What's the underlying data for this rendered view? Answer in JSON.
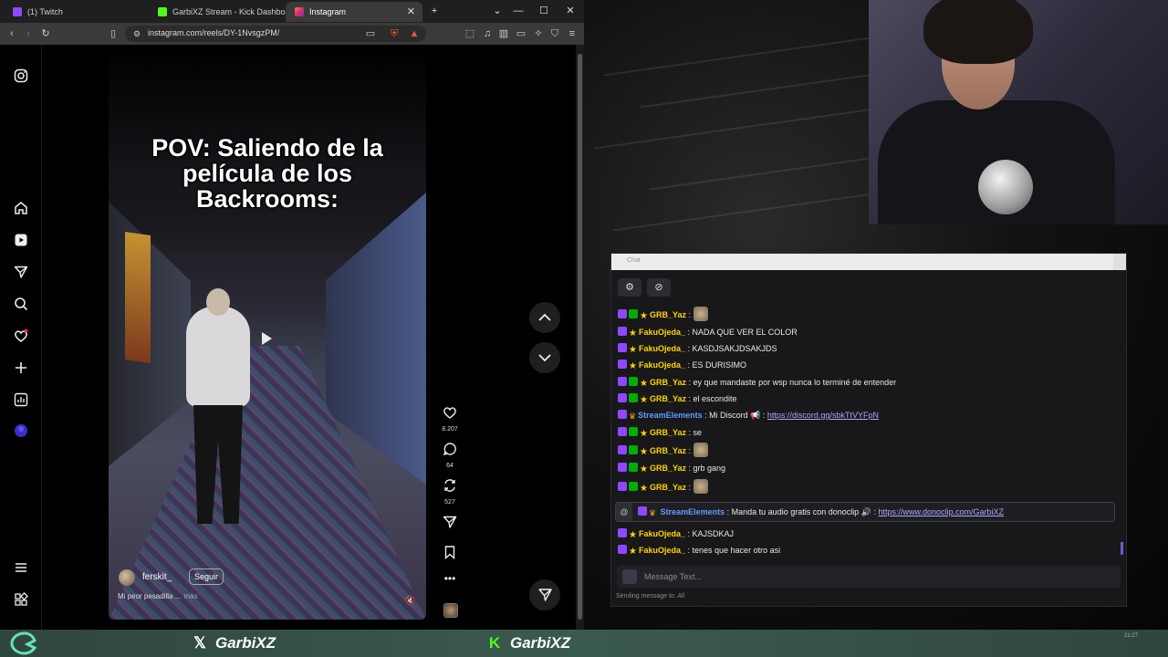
{
  "browser": {
    "tabs": [
      {
        "label": "(1) Twitch",
        "color": "#9147ff"
      },
      {
        "label": "GarbiXZ Stream - Kick Dashboard",
        "color": "#53fc18"
      },
      {
        "label": "Instagram",
        "color": "#e1306c"
      }
    ],
    "active_tab_index": 2,
    "new_tab": "+",
    "url": "instagram.com/reels/DY-1NvsgzPM/"
  },
  "instagram": {
    "sidebar_icons": [
      "instagram-logo-icon",
      "home-icon",
      "reels-icon",
      "send-icon",
      "search-icon",
      "heart-icon",
      "create-icon",
      "dashboard-icon",
      "profile-icon",
      "menu-icon",
      "apps-icon"
    ],
    "reel": {
      "title_lines": [
        "POV: Saliendo de la",
        "película de los",
        "Backrooms:"
      ],
      "username": "ferskit_",
      "follow_label": "Seguir",
      "caption": "Mi peor pesadilla ...",
      "more_label": "más"
    },
    "actions": {
      "likes": "8.207",
      "comments": "64",
      "reposts": "527"
    }
  },
  "chat": {
    "window_title": "Chat",
    "messages": [
      {
        "user": "GRB_Yaz",
        "text": "",
        "emote": true,
        "badges": [
          "twitch",
          "mod",
          "star"
        ],
        "color": "#ffd400"
      },
      {
        "user": "FakuOjeda_",
        "text": "NADA QUE VER EL COLOR",
        "badges": [
          "twitch",
          "star"
        ],
        "color": "#ffd400"
      },
      {
        "user": "FakuOjeda_",
        "text": "KASDJSAKJDSAKJDS",
        "badges": [
          "twitch",
          "star"
        ],
        "color": "#ffd400"
      },
      {
        "user": "FakuOjeda_",
        "text": "ES DURISIMO",
        "badges": [
          "twitch",
          "star"
        ],
        "color": "#ffd400"
      },
      {
        "user": "GRB_Yaz",
        "text": "ey que mandaste por wsp nunca lo terminé de entender",
        "badges": [
          "twitch",
          "mod",
          "star"
        ],
        "color": "#ffd400"
      },
      {
        "user": "GRB_Yaz",
        "text": "el escondite",
        "badges": [
          "twitch",
          "mod",
          "star"
        ],
        "color": "#ffd400"
      },
      {
        "user": "StreamElements",
        "text": "Mi Discord",
        "link": "https://discord.gg/sbkTtVYFpN",
        "badges": [
          "twitch",
          "crown"
        ],
        "color": "#5c9cff"
      },
      {
        "user": "GRB_Yaz",
        "text": "se",
        "badges": [
          "twitch",
          "mod",
          "star"
        ],
        "color": "#ffd400"
      },
      {
        "user": "GRB_Yaz",
        "text": "",
        "emote": true,
        "badges": [
          "twitch",
          "mod",
          "star"
        ],
        "color": "#ffd400"
      },
      {
        "user": "GRB_Yaz",
        "text": "grb gang",
        "badges": [
          "twitch",
          "mod",
          "star"
        ],
        "color": "#ffd400"
      },
      {
        "user": "GRB_Yaz",
        "text": "",
        "emote": true,
        "badges": [
          "twitch",
          "mod",
          "star"
        ],
        "color": "#ffd400"
      }
    ],
    "highlighted": {
      "user": "StreamElements",
      "text": "Manda tu audio gratis con donoclip",
      "link": "https://www.donoclip.com/GarbiXZ"
    },
    "later_messages": [
      {
        "user": "FakuOjeda_",
        "text": "KAJSDKAJ",
        "badges": [
          "twitch",
          "star"
        ],
        "color": "#ffd400"
      },
      {
        "user": "FakuOjeda_",
        "text": "tenes que hacer otro asi",
        "badges": [
          "twitch",
          "star"
        ],
        "color": "#ffd400"
      }
    ],
    "input_placeholder": "Message Text...",
    "footer": "Sending message to: All"
  },
  "bottombar": {
    "x_handle": "GarbiXZ",
    "kick_handle": "GarbiXZ"
  },
  "clock": "21:27"
}
